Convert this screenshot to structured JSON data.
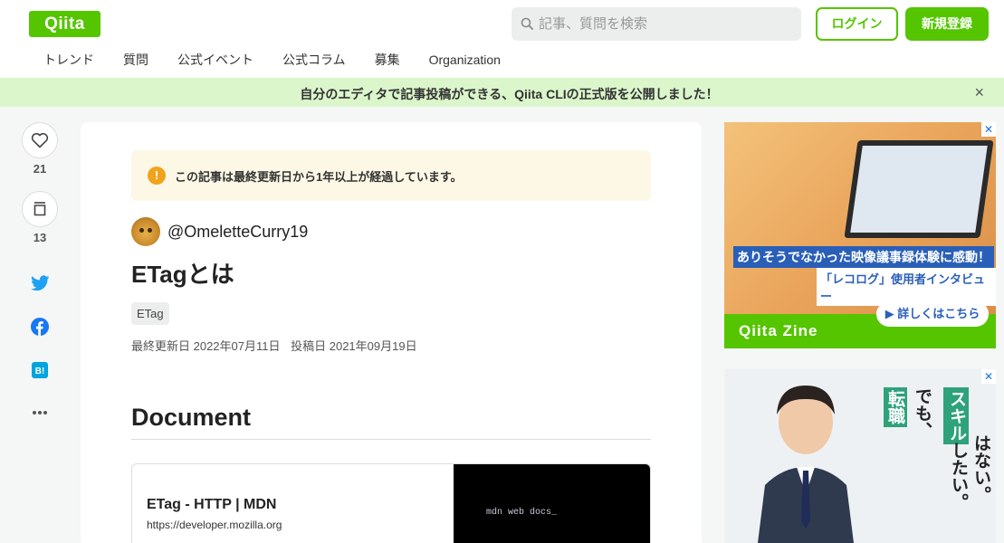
{
  "header": {
    "logo": "Qiita",
    "search_placeholder": "記事、質問を検索",
    "login_label": "ログイン",
    "signup_label": "新規登録",
    "nav": [
      "トレンド",
      "質問",
      "公式イベント",
      "公式コラム",
      "募集",
      "Organization"
    ]
  },
  "banner": {
    "text": "自分のエディタで記事投稿ができる、Qiita CLIの正式版を公開しました！",
    "close": "×"
  },
  "sidebar": {
    "likes": "21",
    "stocks": "13"
  },
  "article": {
    "notice": "この記事は最終更新日から1年以上が経過しています。",
    "notice_icon": "!",
    "author": "@OmeletteCurry19",
    "title": "ETagとは",
    "tag": "ETag",
    "updated": "最終更新日 2022年07月11日",
    "posted": "投稿日 2021年09月19日",
    "heading": "Document",
    "link_card": {
      "title": "ETag - HTTP | MDN",
      "url": "https://developer.mozilla.org",
      "image_text": "mdn web docs_"
    }
  },
  "ads": {
    "ad1": {
      "caption": "ありそうでなかった映像議事録体験に感動！",
      "sub": "「レコログ」使用者インタビュー",
      "brand": "Qiita Zine",
      "cta": "▶ 詳しくはこちら"
    },
    "ad2": {
      "t1": "転職",
      "t2": "でも、",
      "t3": "スキル",
      "t4": "したい。",
      "t5": "はない。"
    }
  },
  "colors": {
    "brand": "#55c500",
    "banner_bg": "#dbf6cb",
    "notice_bg": "#fdf8e6",
    "twitter": "#1da1f2",
    "facebook": "#1877f2",
    "hatena": "#00a4de"
  }
}
